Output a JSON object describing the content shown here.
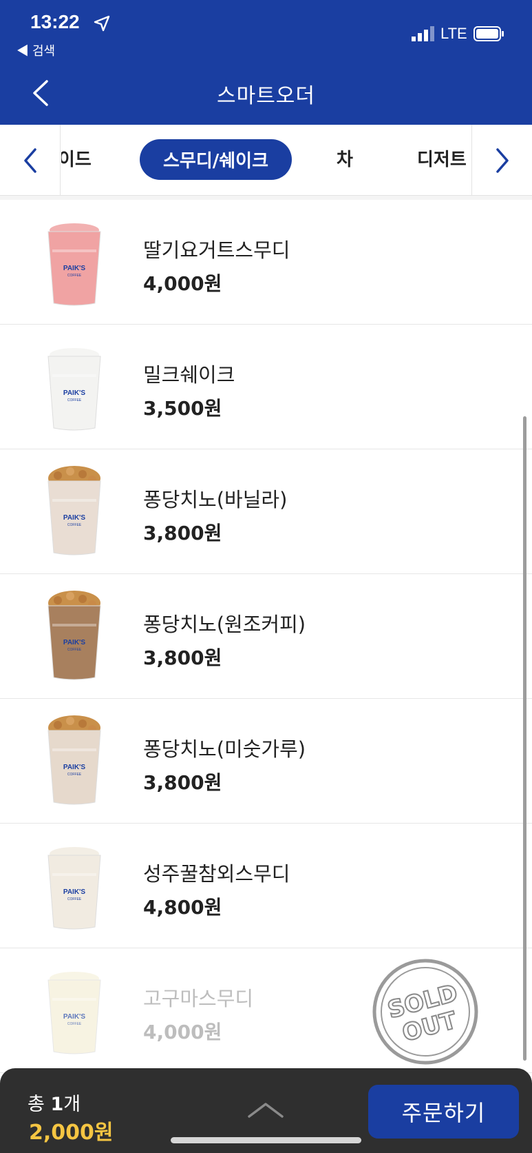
{
  "status_bar": {
    "time": "13:22",
    "back_app": "◀ 검색",
    "network": "LTE"
  },
  "header": {
    "title": "스마트오더"
  },
  "categories": {
    "items": [
      {
        "label": "에이드"
      },
      {
        "label": "스무디/쉐이크"
      },
      {
        "label": "차"
      },
      {
        "label": "디저트"
      }
    ],
    "active": "스무디/쉐이크"
  },
  "menu": {
    "items": [
      {
        "name": "딸기요거트스무디",
        "price": "4,000원",
        "cup_color": "#f0a3a3",
        "sold_out": false
      },
      {
        "name": "밀크쉐이크",
        "price": "3,500원",
        "cup_color": "#f3f3f1",
        "sold_out": false
      },
      {
        "name": "퐁당치노(바닐라)",
        "price": "3,800원",
        "cup_color": "#e9ddd3",
        "sold_out": false
      },
      {
        "name": "퐁당치노(원조커피)",
        "price": "3,800원",
        "cup_color": "#a8805e",
        "sold_out": false
      },
      {
        "name": "퐁당치노(미숫가루)",
        "price": "3,800원",
        "cup_color": "#e6d9cc",
        "sold_out": false
      },
      {
        "name": "성주꿀참외스무디",
        "price": "4,800원",
        "cup_color": "#f1ebe1",
        "sold_out": false
      },
      {
        "name": "고구마스무디",
        "price": "4,000원",
        "cup_color": "#f4efd6",
        "sold_out": true
      }
    ],
    "cup_logo": "PAIK'S",
    "cup_sub": "COFFEE",
    "sold_out_stamp": [
      "SOLD",
      "OUT"
    ]
  },
  "cart": {
    "total_prefix": "총",
    "count": "1",
    "count_unit": "개",
    "total_price": "2,000원",
    "order_button": "주문하기"
  },
  "colors": {
    "brand": "#1a3ea1",
    "price_highlight": "#f5c542",
    "bottom_bar": "#2f2f2f"
  }
}
